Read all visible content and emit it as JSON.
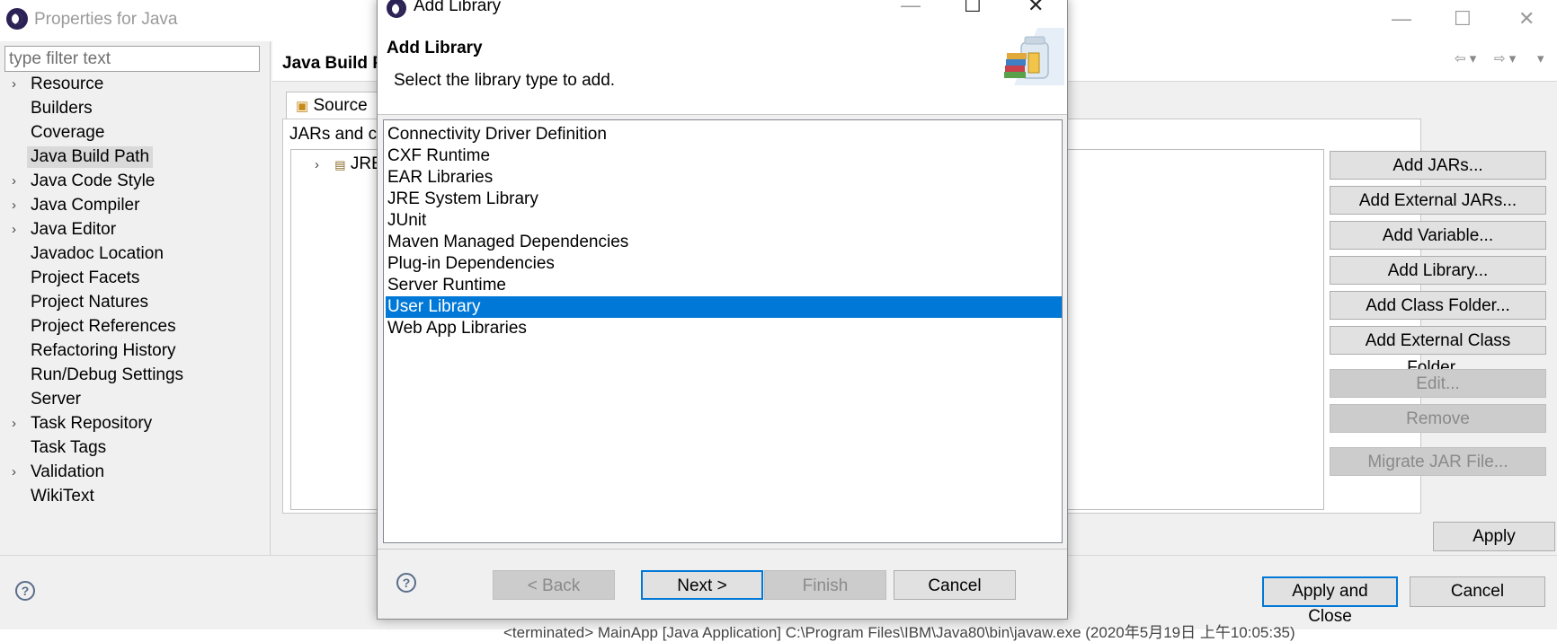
{
  "back_window": {
    "title": "Properties for Java",
    "filter_placeholder": "type filter text",
    "tree": [
      {
        "label": "Resource",
        "expandable": true
      },
      {
        "label": "Builders",
        "expandable": false
      },
      {
        "label": "Coverage",
        "expandable": false
      },
      {
        "label": "Java Build Path",
        "expandable": false,
        "selected": true
      },
      {
        "label": "Java Code Style",
        "expandable": true
      },
      {
        "label": "Java Compiler",
        "expandable": true
      },
      {
        "label": "Java Editor",
        "expandable": true
      },
      {
        "label": "Javadoc Location",
        "expandable": false
      },
      {
        "label": "Project Facets",
        "expandable": false
      },
      {
        "label": "Project Natures",
        "expandable": false
      },
      {
        "label": "Project References",
        "expandable": false
      },
      {
        "label": "Refactoring History",
        "expandable": false
      },
      {
        "label": "Run/Debug Settings",
        "expandable": false
      },
      {
        "label": "Server",
        "expandable": false
      },
      {
        "label": "Task Repository",
        "expandable": true
      },
      {
        "label": "Task Tags",
        "expandable": false
      },
      {
        "label": "Validation",
        "expandable": true
      },
      {
        "label": "WikiText",
        "expandable": false
      }
    ],
    "page_title": "Java Build P",
    "tab_source": "Source",
    "jars_label": "JARs and cl",
    "jre_node": "JRE Sy",
    "side_buttons": [
      {
        "label": "Add JARs...",
        "enabled": true
      },
      {
        "label": "Add External JARs...",
        "enabled": true
      },
      {
        "label": "Add Variable...",
        "enabled": true
      },
      {
        "label": "Add Library...",
        "enabled": true
      },
      {
        "label": "Add Class Folder...",
        "enabled": true
      },
      {
        "label": "Add External Class Folder...",
        "enabled": true
      },
      {
        "label": "Edit...",
        "enabled": false
      },
      {
        "label": "Remove",
        "enabled": false
      },
      {
        "label": "Migrate JAR File...",
        "enabled": false
      }
    ],
    "apply": "Apply",
    "apply_and_close": "Apply and Close",
    "cancel": "Cancel",
    "status_text": "<terminated> MainApp [Java Application] C:\\Program Files\\IBM\\Java80\\bin\\javaw.exe (2020年5月19日 上午10:05:35)"
  },
  "dialog": {
    "title": "Add Library",
    "heading": "Add Library",
    "description": "Select the library type to add.",
    "library_types": [
      "Connectivity Driver Definition",
      "CXF Runtime",
      "EAR Libraries",
      "JRE System Library",
      "JUnit",
      "Maven Managed Dependencies",
      "Plug-in Dependencies",
      "Server Runtime",
      "User Library",
      "Web App Libraries"
    ],
    "selected_library": "User Library",
    "buttons": {
      "back": "< Back",
      "next": "Next >",
      "finish": "Finish",
      "cancel": "Cancel"
    }
  },
  "icons": {
    "help": "?",
    "minimize": "—",
    "maximize": "☐",
    "close": "✕",
    "chevron": "›"
  },
  "colors": {
    "selection": "#0078d7",
    "tree_selection": "#d9d9d9",
    "disabled_button": "#cccccc"
  }
}
